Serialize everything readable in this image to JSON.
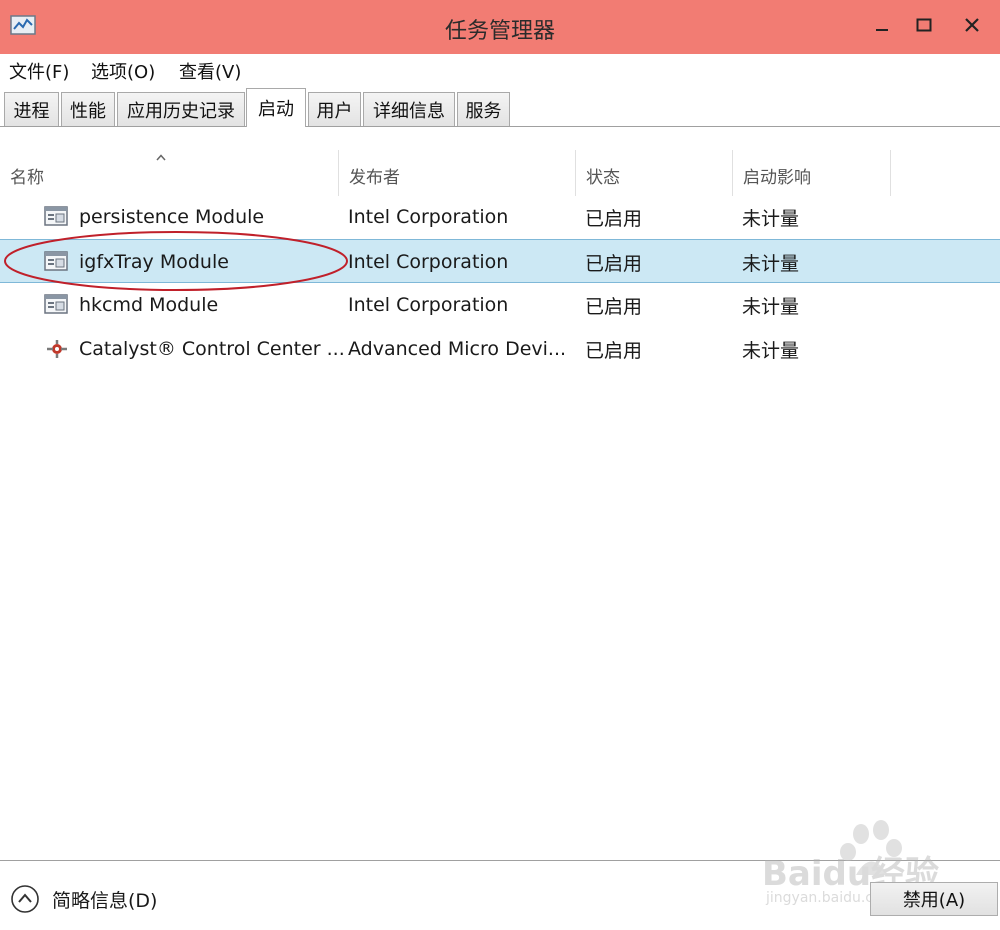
{
  "window": {
    "title": "任务管理器"
  },
  "colors": {
    "titlebar": "#f27c73",
    "selected_row": "#cce8f4",
    "annotation": "#c0202a"
  },
  "menu": {
    "items": [
      "文件(F)",
      "选项(O)",
      "查看(V)"
    ]
  },
  "tabs": {
    "items": [
      "进程",
      "性能",
      "应用历史记录",
      "启动",
      "用户",
      "详细信息",
      "服务"
    ],
    "active": "启动"
  },
  "table": {
    "columns": [
      "名称",
      "发布者",
      "状态",
      "启动影响"
    ],
    "sorted_column": "名称",
    "rows": [
      {
        "icon": "module-window-icon",
        "name": "persistence Module",
        "publisher": "Intel Corporation",
        "status": "已启用",
        "impact": "未计量"
      },
      {
        "icon": "module-window-icon",
        "name": "igfxTray Module",
        "publisher": "Intel Corporation",
        "status": "已启用",
        "impact": "未计量",
        "selected": true,
        "annotated": true
      },
      {
        "icon": "module-window-icon",
        "name": "hkcmd Module",
        "publisher": "Intel Corporation",
        "status": "已启用",
        "impact": "未计量"
      },
      {
        "icon": "amd-catalyst-icon",
        "name": "Catalyst® Control Center ...",
        "publisher": "Advanced Micro Devi...",
        "status": "已启用",
        "impact": "未计量"
      }
    ]
  },
  "footer": {
    "details_label": "简略信息(D)",
    "disable_button": "禁用(A)"
  },
  "watermark": {
    "brand": "Baidu经验",
    "url": "jingyan.baidu.com"
  }
}
